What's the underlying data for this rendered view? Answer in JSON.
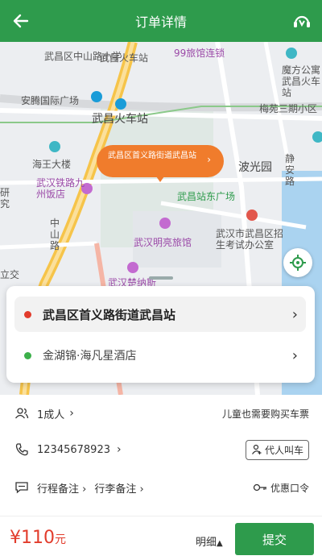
{
  "header": {
    "title": "订单详情",
    "back_icon": "back-arrow-icon",
    "service_icon": "customer-service-icon"
  },
  "map": {
    "labels": {
      "wuchang_zhongshan_school": "武昌区中山路小学",
      "wuchang_bus_station": "武昌火车站",
      "hotel99": "99旅馆连锁",
      "mofang": "魔方公寓武昌火车站",
      "anteng": "安腾国际广场",
      "meiyuan": "梅苑三期小区",
      "wuchang_station": "武昌火车站",
      "haiwang": "海王大楼",
      "bolang": "波光园",
      "jingan": "静安路",
      "railway_hotel": "武汉铁路九州饭店",
      "east_square": "武昌站东广场",
      "zhongshan_road": "中山路",
      "minliang_hotel": "武汉明亮旅馆",
      "exam_office": "武汉市武昌区招生考试办公室",
      "zhanwei": "武汉楚纳斯",
      "lijiao": "立交",
      "dalou": "大楼",
      "yanjiu": "研究"
    },
    "pin_text": "武昌区首义路街道武昌站",
    "locate_icon": "locate-crosshair-icon"
  },
  "address": {
    "from": "武昌区首义路街道武昌站",
    "to": "金湖锦·海凡星酒店"
  },
  "passengers": {
    "label": "1成人",
    "right_text": "儿童也需要购买车票",
    "icon": "people-icon"
  },
  "phone": {
    "number": "12345678923",
    "proxy_label": "代人叫车",
    "icon": "phone-icon"
  },
  "remarks": {
    "trip_note": "行程备注",
    "luggage_note": "行李备注",
    "coupon_label": "优惠口令",
    "icon": "message-icon"
  },
  "footer": {
    "price_symbol": "¥",
    "price": "110",
    "unit": "元",
    "detail_label": "明细",
    "submit_label": "提交"
  },
  "colors": {
    "brand": "#2e9b4c",
    "price": "#e23c2c",
    "pin": "#f07c2c"
  }
}
